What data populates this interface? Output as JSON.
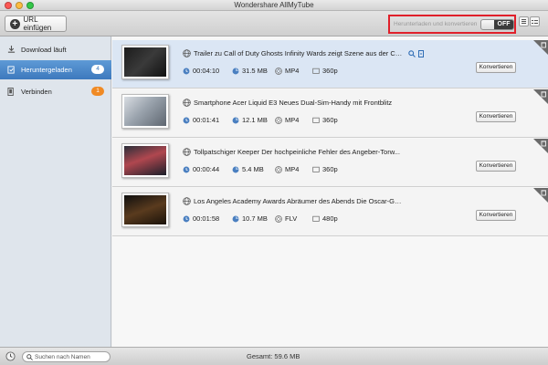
{
  "window": {
    "title": "Wondershare AllMyTube"
  },
  "toolbar": {
    "url_button_label": "URL einfügen",
    "convert_toggle_label": "Herunterladen und konvertieren",
    "toggle_state": "OFF"
  },
  "sidebar": {
    "items": [
      {
        "label": "Download läuft",
        "icon": "download-icon",
        "badge": ""
      },
      {
        "label": "Heruntergeladen",
        "icon": "downloaded-icon",
        "badge": "4",
        "active": true
      },
      {
        "label": "Verbinden",
        "icon": "connect-icon",
        "badge": "1"
      }
    ]
  },
  "videos": [
    {
      "title": "Trailer zu Call of Duty Ghosts  Infinity Wards zeigt Szene aus der Ca...",
      "duration": "00:04:10",
      "size": "31.5 MB",
      "format": "MP4",
      "resolution": "360p",
      "convert_label": "Konvertieren"
    },
    {
      "title": "Smartphone  Acer Liquid E3  Neues Dual-Sim-Handy mit Frontblitz",
      "duration": "00:01:41",
      "size": "12.1 MB",
      "format": "MP4",
      "resolution": "360p",
      "convert_label": "Konvertieren"
    },
    {
      "title": "Tollpatschiger Keeper  Der hochpeinliche Fehler des Angeber-Torw...",
      "duration": "00:00:44",
      "size": "5.4 MB",
      "format": "MP4",
      "resolution": "360p",
      "convert_label": "Konvertieren"
    },
    {
      "title": "Los Angeles Academy Awards  Abräumer des Abends  Die Oscar-Ge...",
      "duration": "00:01:58",
      "size": "10.7 MB",
      "format": "FLV",
      "resolution": "480p",
      "convert_label": "Konvertieren"
    }
  ],
  "status": {
    "search_placeholder": "Suchen nach Namen",
    "total": "Gesamt: 59.6 MB"
  },
  "colors": {
    "accent": "#3d79bd",
    "highlight_border": "#e0202a",
    "badge_orange": "#f08a24",
    "selected_row": "#dbe6f4"
  }
}
